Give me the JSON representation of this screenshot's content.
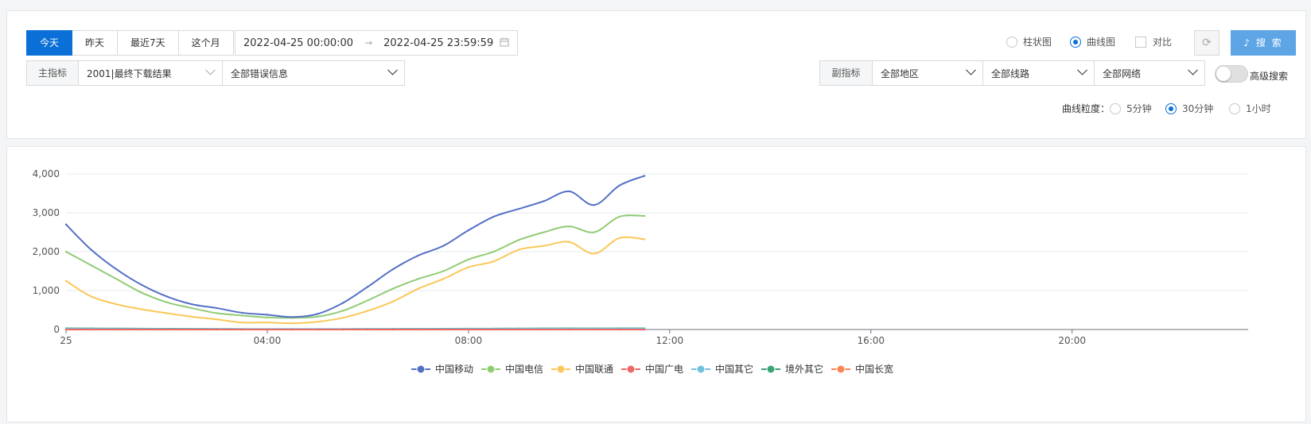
{
  "filters": {
    "time_tabs": [
      "今天",
      "昨天",
      "最近7天",
      "这个月"
    ],
    "active_tab_index": 0,
    "date_start": "2022-04-25 00:00:00",
    "date_end": "2022-04-25 23:59:59",
    "date_arrow": "→",
    "chart_type_options": [
      "柱状图",
      "曲线图"
    ],
    "chart_type_selected": "曲线图",
    "compare_label": "对比",
    "refresh_icon": "refresh-icon",
    "search_label": "♪ 搜 索",
    "main_metric_label": "主指标",
    "main_metric_value": "2001|最终下载结果",
    "error_filter_value": "全部错误信息",
    "sub_metric_label": "副指标",
    "region_value": "全部地区",
    "line_value": "全部线路",
    "network_value": "全部网络",
    "advanced_search_label": "高级搜索",
    "advanced_search_on": false,
    "granularity_label": "曲线粒度：",
    "granularity_options": [
      "5分钟",
      "30分钟",
      "1小时"
    ],
    "granularity_selected": "30分钟",
    "accent_color": "#0a6fd6"
  },
  "chart_data": {
    "type": "line",
    "x_unit": "hours since 00:00",
    "xlim": [
      0,
      23.5
    ],
    "ylim": [
      0,
      4000
    ],
    "y_ticks": [
      0,
      1000,
      2000,
      3000,
      4000
    ],
    "y_tick_labels": [
      "0",
      "1,000",
      "2,000",
      "3,000",
      "4,000"
    ],
    "x_ticks": [
      0,
      4,
      8,
      12,
      16,
      20
    ],
    "x_tick_labels": [
      "25",
      "04:00",
      "08:00",
      "12:00",
      "16:00",
      "20:00"
    ],
    "x": [
      0,
      0.5,
      1,
      1.5,
      2,
      2.5,
      3,
      3.5,
      4,
      4.5,
      5,
      5.5,
      6,
      6.5,
      7,
      7.5,
      8,
      8.5,
      9,
      9.5,
      10,
      10.5,
      11,
      11.5
    ],
    "series": [
      {
        "name": "中国移动",
        "color": "#5470c6",
        "values": [
          2700,
          2050,
          1550,
          1150,
          850,
          650,
          550,
          430,
          380,
          320,
          400,
          680,
          1100,
          1550,
          1900,
          2150,
          2550,
          2900,
          3100,
          3300,
          3550,
          3200,
          3700,
          3950
        ]
      },
      {
        "name": "中国电信",
        "color": "#91cc75",
        "values": [
          2000,
          1650,
          1300,
          950,
          700,
          550,
          420,
          360,
          310,
          300,
          330,
          480,
          750,
          1050,
          1300,
          1500,
          1800,
          2000,
          2300,
          2500,
          2650,
          2500,
          2900,
          2920
        ]
      },
      {
        "name": "中国联通",
        "color": "#fac858",
        "values": [
          1250,
          850,
          650,
          520,
          420,
          330,
          260,
          180,
          180,
          160,
          200,
          300,
          480,
          720,
          1050,
          1300,
          1600,
          1750,
          2050,
          2150,
          2250,
          1950,
          2350,
          2320
        ]
      },
      {
        "name": "中国广电",
        "color": "#ee6666",
        "values": [
          0,
          0,
          0,
          0,
          0,
          0,
          0,
          0,
          0,
          0,
          0,
          0,
          0,
          0,
          0,
          0,
          0,
          0,
          0,
          0,
          0,
          0,
          0,
          0
        ]
      },
      {
        "name": "中国其它",
        "color": "#73c0de",
        "values": [
          20,
          18,
          16,
          15,
          14,
          12,
          10,
          10,
          9,
          9,
          9,
          10,
          12,
          12,
          14,
          15,
          18,
          18,
          20,
          20,
          22,
          20,
          22,
          22
        ]
      },
      {
        "name": "境外其它",
        "color": "#3ba272",
        "values": [
          30,
          28,
          25,
          22,
          20,
          18,
          15,
          14,
          12,
          12,
          12,
          14,
          16,
          16,
          18,
          20,
          22,
          24,
          26,
          28,
          30,
          28,
          30,
          30
        ]
      },
      {
        "name": "中国长宽",
        "color": "#fc8452",
        "values": [
          0,
          0,
          0,
          0,
          0,
          0,
          0,
          0,
          0,
          0,
          0,
          0,
          0,
          0,
          0,
          0,
          0,
          0,
          0,
          0,
          0,
          0,
          0,
          0
        ]
      }
    ],
    "grid": true,
    "legend_position": "bottom-center"
  }
}
